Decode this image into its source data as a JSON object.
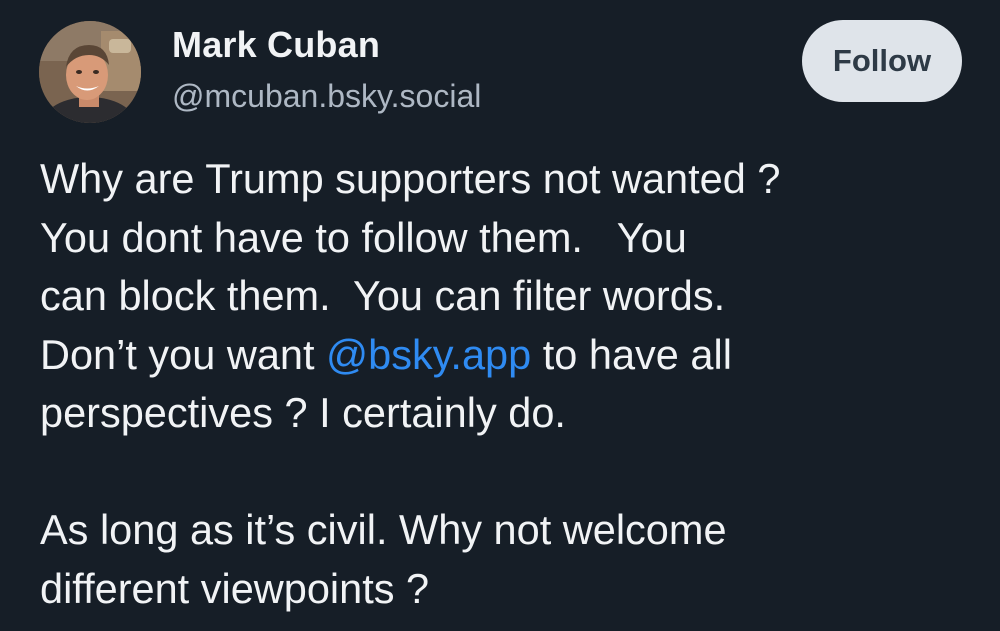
{
  "author": {
    "display_name": "Mark Cuban",
    "handle": "@mcuban.bsky.social",
    "avatar_icon": "user-avatar-photo"
  },
  "follow_button": {
    "label": "Follow"
  },
  "post": {
    "lines": [
      "Why are Trump supporters not wanted ?",
      "You dont have to follow them.   You",
      "can block them.  You can filter words."
    ],
    "line4_prefix": "Don’t you want ",
    "mention": "@bsky.app",
    "line4_suffix": " to have all",
    "line5": "perspectives ? I certainly do.",
    "line6": "As long as it’s civil. Why not welcome",
    "line7": "different viewpoints ?"
  },
  "colors": {
    "background": "#161e27",
    "text": "#f1f3f5",
    "handle": "#aeb8c4",
    "link": "#2f8bf2",
    "button_bg": "#dfe4ea",
    "button_text": "#2e3a46"
  }
}
